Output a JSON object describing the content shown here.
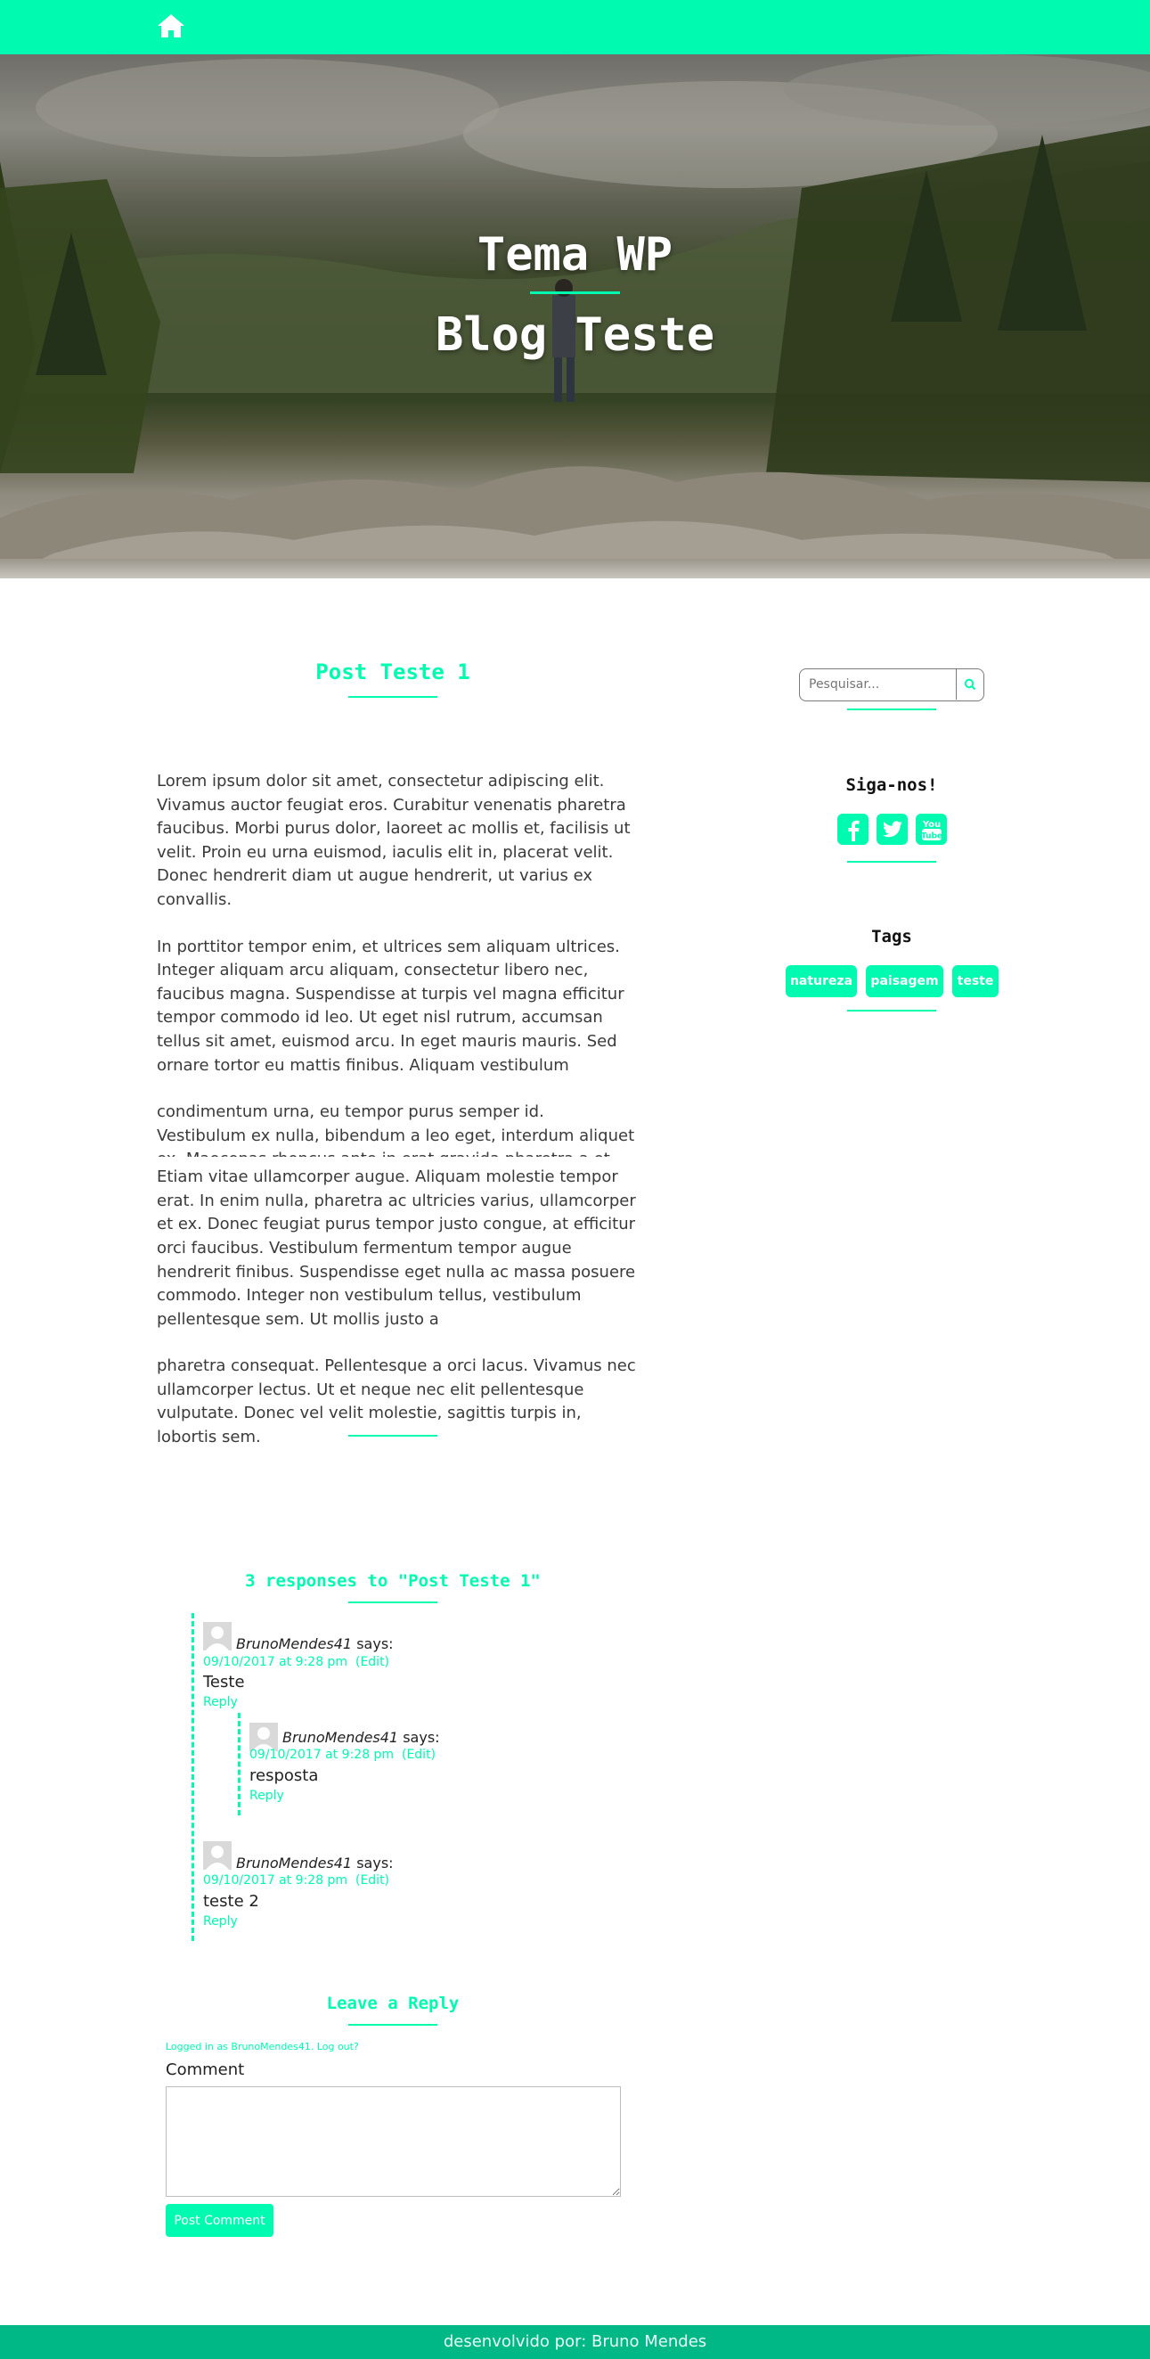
{
  "nav": {
    "home_icon": "home-icon"
  },
  "hero": {
    "title_line1": "Tema WP",
    "title_line2": "Blog Teste"
  },
  "post": {
    "title": "Post Teste 1",
    "paragraphs": [
      "Lorem ipsum dolor sit amet, consectetur adipiscing elit. Vivamus auctor feugiat eros. Curabitur venenatis pharetra faucibus. Morbi purus dolor, laoreet ac mollis et, facilisis ut velit. Proin eu urna euismod, iaculis elit in, placerat velit.",
      "Donec hendrerit diam ut augue hendrerit, ut varius ex convallis.",
      "In porttitor tempor enim, et ultrices sem aliquam ultrices. Integer aliquam arcu aliquam, consectetur libero nec, faucibus magna. Suspendisse at turpis vel magna efficitur tempor commodo id leo. Ut eget nisl rutrum, accumsan tellus sit amet, euismod arcu. In eget mauris mauris. Sed ornare tortor eu mattis finibus. Aliquam vestibulum",
      "condimentum urna, eu tempor purus semper id. Vestibulum ex nulla, bibendum a leo eget, interdum aliquet ex. Maecenas rhoncus ante in erat gravida pharetra a et dolor.",
      "Etiam vitae ullamcorper augue. Aliquam molestie tempor erat. In enim nulla, pharetra ac ultricies varius, ullamcorper et ex. Donec feugiat purus tempor justo congue, at efficitur orci faucibus. Vestibulum fermentum tempor augue hendrerit finibus. Suspendisse eget nulla ac massa posuere commodo. Integer non vestibulum tellus, vestibulum pellentesque sem. Ut mollis justo a",
      "pharetra consequat. Pellentesque a orci lacus. Vivamus nec ullamcorper lectus. Ut et neque nec elit pellentesque vulputate. Donec vel velit molestie, sagittis turpis in, lobortis sem."
    ]
  },
  "sidebar": {
    "search_placeholder": "Pesquisar...",
    "follow_title": "Siga-nos!",
    "social_icons": [
      "facebook-icon",
      "twitter-icon",
      "youtube-icon"
    ],
    "tags_title": "Tags",
    "tags": [
      "natureza",
      "paisagem",
      "teste"
    ]
  },
  "comments": {
    "title": "3 responses to \"Post Teste 1\"",
    "says": "says:",
    "reply_label": "Reply",
    "items": [
      {
        "author": "BrunoMendes41",
        "date": "09/10/2017 at 9:28 pm",
        "edit": "(Edit)",
        "text": "Teste"
      },
      {
        "author": "BrunoMendes41",
        "date": "09/10/2017 at 9:28 pm",
        "edit": "(Edit)",
        "text": "resposta"
      },
      {
        "author": "BrunoMendes41",
        "date": "09/10/2017 at 9:28 pm",
        "edit": "(Edit)",
        "text": "teste 2"
      }
    ]
  },
  "reply_form": {
    "title": "Leave a Reply",
    "logged_in_text": "Logged in as BrunoMendes41. Log out?",
    "comment_label": "Comment",
    "submit_label": "Post Comment"
  },
  "footer": {
    "text": "desenvolvido por: Bruno Mendes"
  },
  "colors": {
    "accent": "#00fab0",
    "footer": "#00b885"
  }
}
